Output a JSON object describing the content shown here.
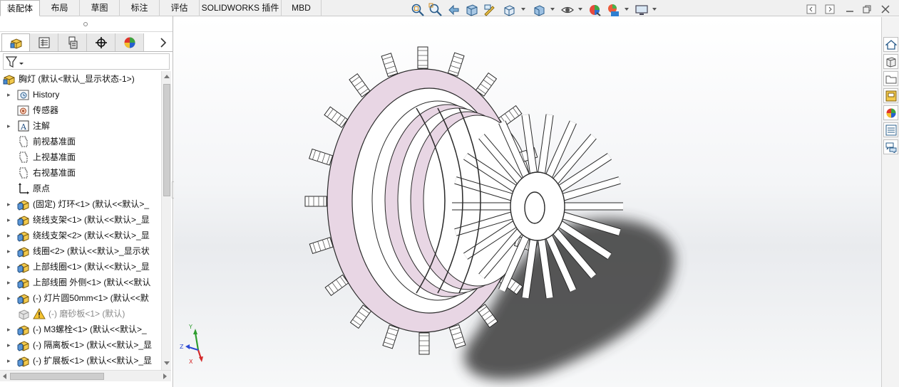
{
  "ribbon": {
    "tabs": [
      {
        "label": "装配体",
        "active": true
      },
      {
        "label": "布局",
        "active": false
      },
      {
        "label": "草图",
        "active": false
      },
      {
        "label": "标注",
        "active": false
      },
      {
        "label": "评估",
        "active": false
      },
      {
        "label": "SOLIDWORKS 插件",
        "active": false
      },
      {
        "label": "MBD",
        "active": false
      }
    ]
  },
  "heads_up_toolbar": {
    "icons": [
      "zoom-to-fit-icon",
      "zoom-to-area-icon",
      "previous-view-icon",
      "section-view-icon",
      "dynamic-annotation-icon",
      "view-orientation-icon",
      "display-style-icon",
      "hide-show-items-icon",
      "edit-appearance-icon",
      "apply-scene-icon",
      "view-settings-icon"
    ]
  },
  "feature_manager": {
    "tabs": [
      "feature-manager-tab",
      "property-manager-tab",
      "configuration-manager-tab",
      "dimxpert-manager-tab",
      "display-manager-tab"
    ],
    "tree": [
      {
        "label": "胸灯  (默认<默认_显示状态-1>)",
        "icon": "assembly-icon",
        "expander": false,
        "indent": 0,
        "dim": false
      },
      {
        "label": "History",
        "icon": "history-icon",
        "expander": true,
        "indent": 1,
        "dim": false
      },
      {
        "label": "传感器",
        "icon": "sensor-icon",
        "expander": false,
        "indent": 1,
        "dim": false
      },
      {
        "label": "注解",
        "icon": "annotation-icon",
        "expander": true,
        "indent": 1,
        "dim": false
      },
      {
        "label": "前视基准面",
        "icon": "plane-icon",
        "expander": false,
        "indent": 1,
        "dim": false
      },
      {
        "label": "上视基准面",
        "icon": "plane-icon",
        "expander": false,
        "indent": 1,
        "dim": false
      },
      {
        "label": "右视基准面",
        "icon": "plane-icon",
        "expander": false,
        "indent": 1,
        "dim": false
      },
      {
        "label": "原点",
        "icon": "origin-icon",
        "expander": false,
        "indent": 1,
        "dim": false
      },
      {
        "label": "(固定) 灯环<1> (默认<<默认>_",
        "icon": "part-icon",
        "expander": true,
        "indent": 1,
        "dim": false
      },
      {
        "label": "绕线支架<1> (默认<<默认>_显",
        "icon": "part-icon",
        "expander": true,
        "indent": 1,
        "dim": false
      },
      {
        "label": "绕线支架<2> (默认<<默认>_显",
        "icon": "part-icon",
        "expander": true,
        "indent": 1,
        "dim": false
      },
      {
        "label": "线圈<2> (默认<<默认>_显示状",
        "icon": "part-icon",
        "expander": true,
        "indent": 1,
        "dim": false
      },
      {
        "label": "上部线圈<1> (默认<<默认>_显",
        "icon": "part-icon",
        "expander": true,
        "indent": 1,
        "dim": false
      },
      {
        "label": "上部线圈 外侧<1> (默认<<默认",
        "icon": "part-icon",
        "expander": true,
        "indent": 1,
        "dim": false
      },
      {
        "label": "(-) 灯片圆50mm<1> (默认<<默",
        "icon": "part-icon",
        "expander": true,
        "indent": 1,
        "dim": false
      },
      {
        "label": "(-) 磨砂板<1> (默认)",
        "icon": "warning-part-icon",
        "expander": false,
        "indent": 1,
        "dim": true
      },
      {
        "label": "(-) M3螺栓<1> (默认<<默认>_",
        "icon": "part-icon",
        "expander": true,
        "indent": 1,
        "dim": false
      },
      {
        "label": "(-) 隔离板<1> (默认<<默认>_显",
        "icon": "part-icon",
        "expander": true,
        "indent": 1,
        "dim": false
      },
      {
        "label": "(-) 扩展板<1> (默认<<默认>_显",
        "icon": "part-icon",
        "expander": true,
        "indent": 1,
        "dim": false
      }
    ]
  },
  "viewport": {
    "triad_labels": {
      "x": "X",
      "y": "Y",
      "z": "Z"
    },
    "model_colors": {
      "face": "#ffffff",
      "accent": "#e8d6e4",
      "edge": "#2a2a2a",
      "shadow": "#3a3a3a"
    }
  },
  "task_pane": {
    "icons": [
      "solidworks-resources-icon",
      "design-library-icon",
      "file-explorer-icon",
      "view-palette-icon",
      "appearances-icon",
      "custom-properties-icon",
      "forum-icon"
    ]
  }
}
